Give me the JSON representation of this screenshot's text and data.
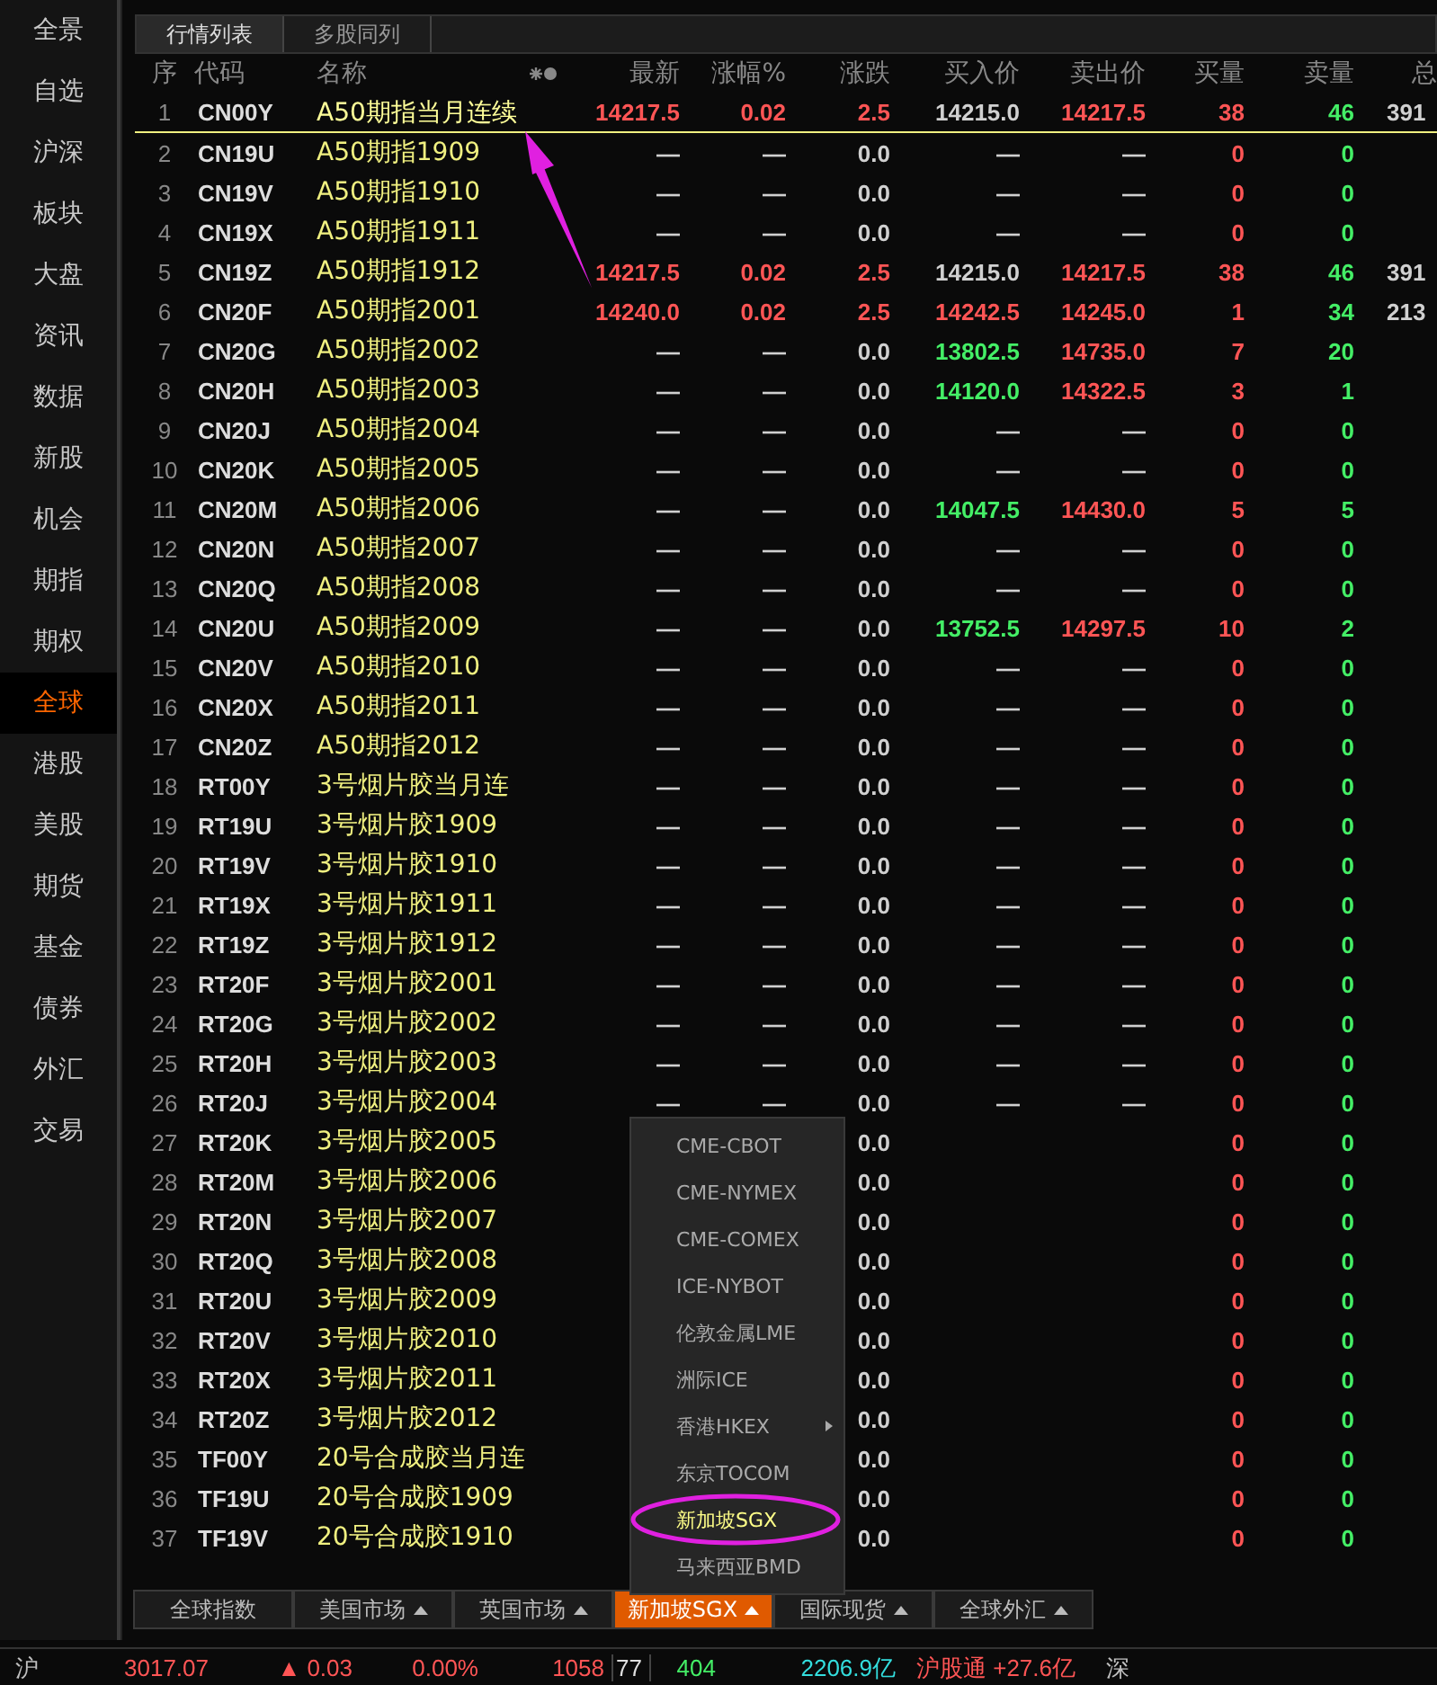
{
  "sidebar": {
    "items": [
      {
        "label": "全景",
        "selected": false
      },
      {
        "label": "自选",
        "selected": false
      },
      {
        "label": "沪深",
        "selected": false
      },
      {
        "label": "板块",
        "selected": false
      },
      {
        "label": "大盘",
        "selected": false
      },
      {
        "label": "资讯",
        "selected": false
      },
      {
        "label": "数据",
        "selected": false
      },
      {
        "label": "新股",
        "selected": false
      },
      {
        "label": "机会",
        "selected": false
      },
      {
        "label": "期指",
        "selected": false
      },
      {
        "label": "期权",
        "selected": false
      },
      {
        "label": "全球",
        "selected": true
      },
      {
        "label": "港股",
        "selected": false
      },
      {
        "label": "美股",
        "selected": false
      },
      {
        "label": "期货",
        "selected": false
      },
      {
        "label": "基金",
        "selected": false
      },
      {
        "label": "债券",
        "selected": false
      },
      {
        "label": "外汇",
        "selected": false
      },
      {
        "label": "交易",
        "selected": false
      }
    ]
  },
  "tabs": [
    {
      "label": "行情列表",
      "selected": true
    },
    {
      "label": "多股同列",
      "selected": false
    }
  ],
  "table": {
    "columns": [
      "序",
      "代码",
      "名称",
      "最新",
      "涨幅%",
      "涨跌",
      "买入价",
      "卖出价",
      "买量",
      "卖量",
      "总"
    ],
    "rows": [
      {
        "num": "1",
        "code": "CN00Y",
        "name": "A50期指当月连续",
        "selected": true,
        "rising": true,
        "last": "14217.5",
        "pct": "0.02",
        "chg": "2.5",
        "bid": {
          "text": "14215.0",
          "color": "#d0d0d0"
        },
        "ask": {
          "text": "14217.5",
          "color": "#ff5555"
        },
        "bid_vol": "38",
        "ask_vol": "46",
        "total": "391"
      },
      {
        "num": "2",
        "code": "CN19U",
        "name": "A50期指1909",
        "selected": false,
        "rising": false,
        "last": "—",
        "pct": "—",
        "chg": "0.0",
        "bid": {
          "text": "—",
          "color": "#d0d0d0"
        },
        "ask": {
          "text": "—",
          "color": "#d0d0d0"
        },
        "bid_vol": "0",
        "ask_vol": "0"
      },
      {
        "num": "3",
        "code": "CN19V",
        "name": "A50期指1910",
        "selected": false,
        "rising": false,
        "last": "—",
        "pct": "—",
        "chg": "0.0",
        "bid": {
          "text": "—",
          "color": "#d0d0d0"
        },
        "ask": {
          "text": "—",
          "color": "#d0d0d0"
        },
        "bid_vol": "0",
        "ask_vol": "0"
      },
      {
        "num": "4",
        "code": "CN19X",
        "name": "A50期指1911",
        "selected": false,
        "rising": false,
        "last": "—",
        "pct": "—",
        "chg": "0.0",
        "bid": {
          "text": "—",
          "color": "#d0d0d0"
        },
        "ask": {
          "text": "—",
          "color": "#d0d0d0"
        },
        "bid_vol": "0",
        "ask_vol": "0"
      },
      {
        "num": "5",
        "code": "CN19Z",
        "name": "A50期指1912",
        "selected": false,
        "rising": true,
        "last": "14217.5",
        "pct": "0.02",
        "chg": "2.5",
        "bid": {
          "text": "14215.0",
          "color": "#d0d0d0"
        },
        "ask": {
          "text": "14217.5",
          "color": "#ff5555"
        },
        "bid_vol": "38",
        "ask_vol": "46",
        "total": "391"
      },
      {
        "num": "6",
        "code": "CN20F",
        "name": "A50期指2001",
        "selected": false,
        "rising": true,
        "last": "14240.0",
        "pct": "0.02",
        "chg": "2.5",
        "bid": {
          "text": "14242.5",
          "color": "#ff5555"
        },
        "ask": {
          "text": "14245.0",
          "color": "#ff5555"
        },
        "bid_vol": "1",
        "ask_vol": "34",
        "total": "213"
      },
      {
        "num": "7",
        "code": "CN20G",
        "name": "A50期指2002",
        "selected": false,
        "rising": false,
        "last": "—",
        "pct": "—",
        "chg": "0.0",
        "bid": {
          "text": "13802.5",
          "color": "#44ee66"
        },
        "ask": {
          "text": "14735.0",
          "color": "#ff5555"
        },
        "bid_vol": "7",
        "ask_vol": "20"
      },
      {
        "num": "8",
        "code": "CN20H",
        "name": "A50期指2003",
        "selected": false,
        "rising": false,
        "last": "—",
        "pct": "—",
        "chg": "0.0",
        "bid": {
          "text": "14120.0",
          "color": "#44ee66"
        },
        "ask": {
          "text": "14322.5",
          "color": "#ff5555"
        },
        "bid_vol": "3",
        "ask_vol": "1"
      },
      {
        "num": "9",
        "code": "CN20J",
        "name": "A50期指2004",
        "selected": false,
        "rising": false,
        "last": "—",
        "pct": "—",
        "chg": "0.0",
        "bid": {
          "text": "—",
          "color": "#d0d0d0"
        },
        "ask": {
          "text": "—",
          "color": "#d0d0d0"
        },
        "bid_vol": "0",
        "ask_vol": "0"
      },
      {
        "num": "10",
        "code": "CN20K",
        "name": "A50期指2005",
        "selected": false,
        "rising": false,
        "last": "—",
        "pct": "—",
        "chg": "0.0",
        "bid": {
          "text": "—",
          "color": "#d0d0d0"
        },
        "ask": {
          "text": "—",
          "color": "#d0d0d0"
        },
        "bid_vol": "0",
        "ask_vol": "0"
      },
      {
        "num": "11",
        "code": "CN20M",
        "name": "A50期指2006",
        "selected": false,
        "rising": false,
        "last": "—",
        "pct": "—",
        "chg": "0.0",
        "bid": {
          "text": "14047.5",
          "color": "#44ee66"
        },
        "ask": {
          "text": "14430.0",
          "color": "#ff5555"
        },
        "bid_vol": "5",
        "ask_vol": "5"
      },
      {
        "num": "12",
        "code": "CN20N",
        "name": "A50期指2007",
        "selected": false,
        "rising": false,
        "last": "—",
        "pct": "—",
        "chg": "0.0",
        "bid": {
          "text": "—",
          "color": "#d0d0d0"
        },
        "ask": {
          "text": "—",
          "color": "#d0d0d0"
        },
        "bid_vol": "0",
        "ask_vol": "0"
      },
      {
        "num": "13",
        "code": "CN20Q",
        "name": "A50期指2008",
        "selected": false,
        "rising": false,
        "last": "—",
        "pct": "—",
        "chg": "0.0",
        "bid": {
          "text": "—",
          "color": "#d0d0d0"
        },
        "ask": {
          "text": "—",
          "color": "#d0d0d0"
        },
        "bid_vol": "0",
        "ask_vol": "0"
      },
      {
        "num": "14",
        "code": "CN20U",
        "name": "A50期指2009",
        "selected": false,
        "rising": false,
        "last": "—",
        "pct": "—",
        "chg": "0.0",
        "bid": {
          "text": "13752.5",
          "color": "#44ee66"
        },
        "ask": {
          "text": "14297.5",
          "color": "#ff5555"
        },
        "bid_vol": "10",
        "ask_vol": "2"
      },
      {
        "num": "15",
        "code": "CN20V",
        "name": "A50期指2010",
        "selected": false,
        "rising": false,
        "last": "—",
        "pct": "—",
        "chg": "0.0",
        "bid": {
          "text": "—",
          "color": "#d0d0d0"
        },
        "ask": {
          "text": "—",
          "color": "#d0d0d0"
        },
        "bid_vol": "0",
        "ask_vol": "0"
      },
      {
        "num": "16",
        "code": "CN20X",
        "name": "A50期指2011",
        "selected": false,
        "rising": false,
        "last": "—",
        "pct": "—",
        "chg": "0.0",
        "bid": {
          "text": "—",
          "color": "#d0d0d0"
        },
        "ask": {
          "text": "—",
          "color": "#d0d0d0"
        },
        "bid_vol": "0",
        "ask_vol": "0"
      },
      {
        "num": "17",
        "code": "CN20Z",
        "name": "A50期指2012",
        "selected": false,
        "rising": false,
        "last": "—",
        "pct": "—",
        "chg": "0.0",
        "bid": {
          "text": "—",
          "color": "#d0d0d0"
        },
        "ask": {
          "text": "—",
          "color": "#d0d0d0"
        },
        "bid_vol": "0",
        "ask_vol": "0"
      },
      {
        "num": "18",
        "code": "RT00Y",
        "name": "3号烟片胶当月连",
        "selected": false,
        "rising": false,
        "last": "—",
        "pct": "—",
        "chg": "0.0",
        "bid": {
          "text": "—",
          "color": "#d0d0d0"
        },
        "ask": {
          "text": "—",
          "color": "#d0d0d0"
        },
        "bid_vol": "0",
        "ask_vol": "0"
      },
      {
        "num": "19",
        "code": "RT19U",
        "name": "3号烟片胶1909",
        "selected": false,
        "rising": false,
        "last": "—",
        "pct": "—",
        "chg": "0.0",
        "bid": {
          "text": "—",
          "color": "#d0d0d0"
        },
        "ask": {
          "text": "—",
          "color": "#d0d0d0"
        },
        "bid_vol": "0",
        "ask_vol": "0"
      },
      {
        "num": "20",
        "code": "RT19V",
        "name": "3号烟片胶1910",
        "selected": false,
        "rising": false,
        "last": "—",
        "pct": "—",
        "chg": "0.0",
        "bid": {
          "text": "—",
          "color": "#d0d0d0"
        },
        "ask": {
          "text": "—",
          "color": "#d0d0d0"
        },
        "bid_vol": "0",
        "ask_vol": "0"
      },
      {
        "num": "21",
        "code": "RT19X",
        "name": "3号烟片胶1911",
        "selected": false,
        "rising": false,
        "last": "—",
        "pct": "—",
        "chg": "0.0",
        "bid": {
          "text": "—",
          "color": "#d0d0d0"
        },
        "ask": {
          "text": "—",
          "color": "#d0d0d0"
        },
        "bid_vol": "0",
        "ask_vol": "0"
      },
      {
        "num": "22",
        "code": "RT19Z",
        "name": "3号烟片胶1912",
        "selected": false,
        "rising": false,
        "last": "—",
        "pct": "—",
        "chg": "0.0",
        "bid": {
          "text": "—",
          "color": "#d0d0d0"
        },
        "ask": {
          "text": "—",
          "color": "#d0d0d0"
        },
        "bid_vol": "0",
        "ask_vol": "0"
      },
      {
        "num": "23",
        "code": "RT20F",
        "name": "3号烟片胶2001",
        "selected": false,
        "rising": false,
        "last": "—",
        "pct": "—",
        "chg": "0.0",
        "bid": {
          "text": "—",
          "color": "#d0d0d0"
        },
        "ask": {
          "text": "—",
          "color": "#d0d0d0"
        },
        "bid_vol": "0",
        "ask_vol": "0"
      },
      {
        "num": "24",
        "code": "RT20G",
        "name": "3号烟片胶2002",
        "selected": false,
        "rising": false,
        "last": "—",
        "pct": "—",
        "chg": "0.0",
        "bid": {
          "text": "—",
          "color": "#d0d0d0"
        },
        "ask": {
          "text": "—",
          "color": "#d0d0d0"
        },
        "bid_vol": "0",
        "ask_vol": "0"
      },
      {
        "num": "25",
        "code": "RT20H",
        "name": "3号烟片胶2003",
        "selected": false,
        "rising": false,
        "last": "—",
        "pct": "—",
        "chg": "0.0",
        "bid": {
          "text": "—",
          "color": "#d0d0d0"
        },
        "ask": {
          "text": "—",
          "color": "#d0d0d0"
        },
        "bid_vol": "0",
        "ask_vol": "0"
      },
      {
        "num": "26",
        "code": "RT20J",
        "name": "3号烟片胶2004",
        "selected": false,
        "rising": false,
        "last": "—",
        "pct": "—",
        "chg": "0.0",
        "bid": {
          "text": "—",
          "color": "#d0d0d0"
        },
        "ask": {
          "text": "—",
          "color": "#d0d0d0"
        },
        "bid_vol": "0",
        "ask_vol": "0"
      },
      {
        "num": "27",
        "code": "RT20K",
        "name": "3号烟片胶2005",
        "selected": false,
        "rising": false,
        "chg": "0.0",
        "bid_vol": "0",
        "ask_vol": "0"
      },
      {
        "num": "28",
        "code": "RT20M",
        "name": "3号烟片胶2006",
        "selected": false,
        "rising": false,
        "chg": "0.0",
        "bid_vol": "0",
        "ask_vol": "0"
      },
      {
        "num": "29",
        "code": "RT20N",
        "name": "3号烟片胶2007",
        "selected": false,
        "rising": false,
        "chg": "0.0",
        "bid_vol": "0",
        "ask_vol": "0"
      },
      {
        "num": "30",
        "code": "RT20Q",
        "name": "3号烟片胶2008",
        "selected": false,
        "rising": false,
        "chg": "0.0",
        "bid_vol": "0",
        "ask_vol": "0"
      },
      {
        "num": "31",
        "code": "RT20U",
        "name": "3号烟片胶2009",
        "selected": false,
        "rising": false,
        "chg": "0.0",
        "bid_vol": "0",
        "ask_vol": "0"
      },
      {
        "num": "32",
        "code": "RT20V",
        "name": "3号烟片胶2010",
        "selected": false,
        "rising": false,
        "chg": "0.0",
        "bid_vol": "0",
        "ask_vol": "0"
      },
      {
        "num": "33",
        "code": "RT20X",
        "name": "3号烟片胶2011",
        "selected": false,
        "rising": false,
        "chg": "0.0",
        "bid_vol": "0",
        "ask_vol": "0"
      },
      {
        "num": "34",
        "code": "RT20Z",
        "name": "3号烟片胶2012",
        "selected": false,
        "rising": false,
        "chg": "0.0",
        "bid_vol": "0",
        "ask_vol": "0"
      },
      {
        "num": "35",
        "code": "TF00Y",
        "name": "20号合成胶当月连",
        "selected": false,
        "rising": false,
        "chg": "0.0",
        "bid_vol": "0",
        "ask_vol": "0"
      },
      {
        "num": "36",
        "code": "TF19U",
        "name": "20号合成胶1909",
        "selected": false,
        "rising": false,
        "chg": "0.0",
        "bid_vol": "0",
        "ask_vol": "0"
      },
      {
        "num": "37",
        "code": "TF19V",
        "name": "20号合成胶1910",
        "selected": false,
        "rising": false,
        "chg": "0.0",
        "bid_vol": "0",
        "ask_vol": "0"
      }
    ]
  },
  "menu": {
    "items": [
      {
        "label": "CME-CBOT",
        "selected": false,
        "submenu": false
      },
      {
        "label": "CME-NYMEX",
        "selected": false,
        "submenu": false
      },
      {
        "label": "CME-COMEX",
        "selected": false,
        "submenu": false
      },
      {
        "label": "ICE-NYBOT",
        "selected": false,
        "submenu": false
      },
      {
        "label": "伦敦金属LME",
        "selected": false,
        "submenu": false
      },
      {
        "label": "洲际ICE",
        "selected": false,
        "submenu": false
      },
      {
        "label": "香港HKEX",
        "selected": false,
        "submenu": true
      },
      {
        "label": "东京TOCOM",
        "selected": false,
        "submenu": false
      },
      {
        "label": "新加坡SGX",
        "selected": true,
        "submenu": false
      },
      {
        "label": "马来西亚BMD",
        "selected": false,
        "submenu": false
      }
    ]
  },
  "bottom_tabs": [
    {
      "label": "全球指数",
      "selected": false,
      "dropdown": false
    },
    {
      "label": "美国市场",
      "selected": false,
      "dropdown": true
    },
    {
      "label": "英国市场",
      "selected": false,
      "dropdown": true
    },
    {
      "label": "新加坡SGX",
      "selected": true,
      "dropdown": true
    },
    {
      "label": "国际现货",
      "selected": false,
      "dropdown": true
    },
    {
      "label": "全球外汇",
      "selected": false,
      "dropdown": true
    }
  ],
  "status_bar": [
    {
      "text": "沪",
      "color": "#c0c0c0"
    },
    {
      "text": "3017.07",
      "color": "#ff5555"
    },
    {
      "text": "▲ 0.03",
      "color": "#ff5555"
    },
    {
      "text": "0.00%",
      "color": "#ff5555"
    },
    {
      "text": "1058",
      "color": "#ff5555"
    },
    {
      "text": "77",
      "color": "#e0e0e0"
    },
    {
      "text": "404",
      "color": "#44ee66"
    },
    {
      "text": "2206.9亿",
      "color": "#33dddd"
    },
    {
      "text": "沪股通 +27.6亿",
      "color": "#ff5555"
    },
    {
      "text": "深",
      "color": "#c0c0c0"
    }
  ]
}
